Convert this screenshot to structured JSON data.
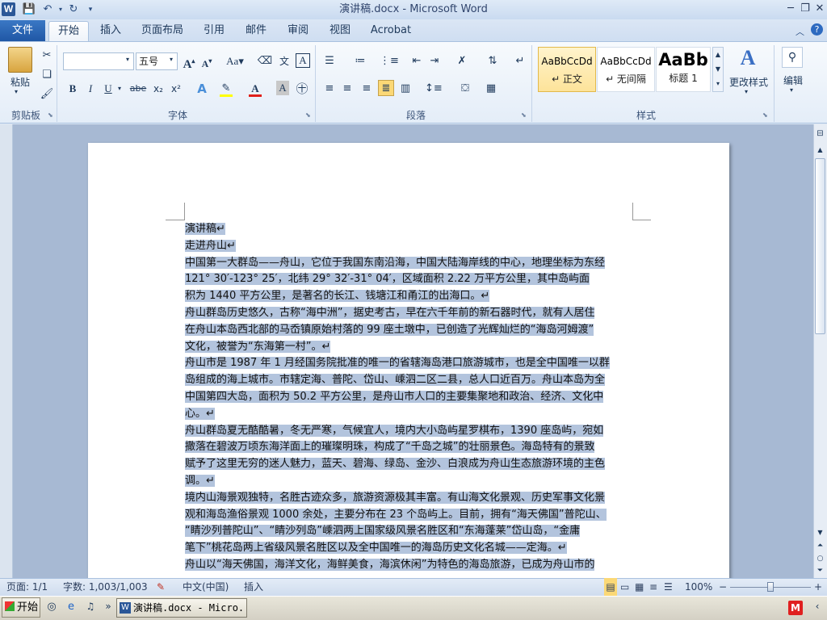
{
  "window": {
    "title": "演讲稿.docx - Microsoft Word",
    "app_icon": "W",
    "minimize": "─",
    "restore": "❐",
    "close": "✕"
  },
  "quick_access": {
    "save": "save-icon",
    "undo": "undo-icon",
    "redo": "redo-icon",
    "customize": "customize-icon"
  },
  "tabs": {
    "file": "文件",
    "items": [
      "开始",
      "插入",
      "页面布局",
      "引用",
      "邮件",
      "审阅",
      "视图",
      "Acrobat"
    ]
  },
  "ribbon": {
    "clipboard": {
      "label": "剪贴板",
      "paste": "粘贴"
    },
    "font": {
      "label": "字体",
      "font_name": "",
      "font_size": "五号",
      "grow": "A",
      "shrink": "A",
      "case": "Aa",
      "bold": "B",
      "italic": "I",
      "underline": "U",
      "strike": "abe",
      "sub": "x₂",
      "sup": "x²",
      "clear": "A",
      "color": "A"
    },
    "paragraph": {
      "label": "段落"
    },
    "styles": {
      "label": "样式",
      "items": [
        {
          "preview": "AaBbCcDd",
          "name": "↵ 正文"
        },
        {
          "preview": "AaBbCcDd",
          "name": "↵ 无间隔"
        },
        {
          "preview": "AaBb",
          "name": "标题 1"
        }
      ],
      "change_styles": "更改样式"
    },
    "editing": {
      "label": "编辑"
    }
  },
  "document": {
    "lines": [
      "演讲稿↵",
      "走进舟山↵",
      "中国第一大群岛——舟山，它位于我国东南沿海，中国大陆海岸线的中心，地理坐标为东经",
      "121° 30′-123° 25′，北纬 29° 32′-31° 04′，区域面积 2.22 万平方公里，其中岛屿面",
      "积为 1440 平方公里，是著名的长江、钱塘江和甬江的出海口。↵",
      "舟山群岛历史悠久，古称“海中洲”，据史考古，早在六千年前的新石器时代，就有人居住",
      "在舟山本岛西北部的马岙镇原始村落的 99 座土墩中，已创造了光辉灿烂的“海岛河姆渡”",
      "文化，被誉为“东海第一村”。↵",
      "舟山市是 1987 年 1 月经国务院批准的唯一的省辖海岛港口旅游城市，也是全中国唯一以群",
      "岛组成的海上城市。市辖定海、普陀、岱山、嵊泗二区二县，总人口近百万。舟山本岛为全",
      "中国第四大岛，面积为 50.2 平方公里，是舟山市人口的主要集聚地和政治、经济、文化中",
      "心。↵",
      "舟山群岛夏无酷酷暑，冬无严寒，气候宜人，境内大小岛屿星罗棋布，1390 座岛屿，宛如",
      "撒落在碧波万顷东海洋面上的璀璨明珠，构成了“千岛之城”的壮丽景色。海岛特有的景致",
      "赋予了这里无穷的迷人魅力，蓝天、碧海、绿岛、金沙、白浪成为舟山生态旅游环境的主色",
      "调。↵",
      "境内山海景观独特，名胜古迹众多，旅游资源极其丰富。有山海文化景观、历史军事文化景",
      "观和海岛渔俗景观 1000 余处，主要分布在 23 个岛屿上。目前，拥有“海天佛国”普陀山、",
      "“睛沙列普陀山”、“睛沙列岛”嵊泗两上国家级风景名胜区和“东海蓬莱”岱山岛，“金庸",
      "笔下”桃花岛两上省级风景名胜区以及全中国唯一的海岛历史文化名城——定海。↵",
      "舟山以“海天佛国，海洋文化，海鲜美食，海滨休闲”为特色的海岛旅游，已成为舟山市的"
    ]
  },
  "status": {
    "page": "页面: 1/1",
    "words": "字数: 1,003/1,003",
    "language": "中文(中国)",
    "mode": "插入",
    "zoom": "100%",
    "zoom_out": "−",
    "zoom_in": "+"
  },
  "taskbar": {
    "start": "开始",
    "item": "演讲稿.docx - Micro..."
  }
}
